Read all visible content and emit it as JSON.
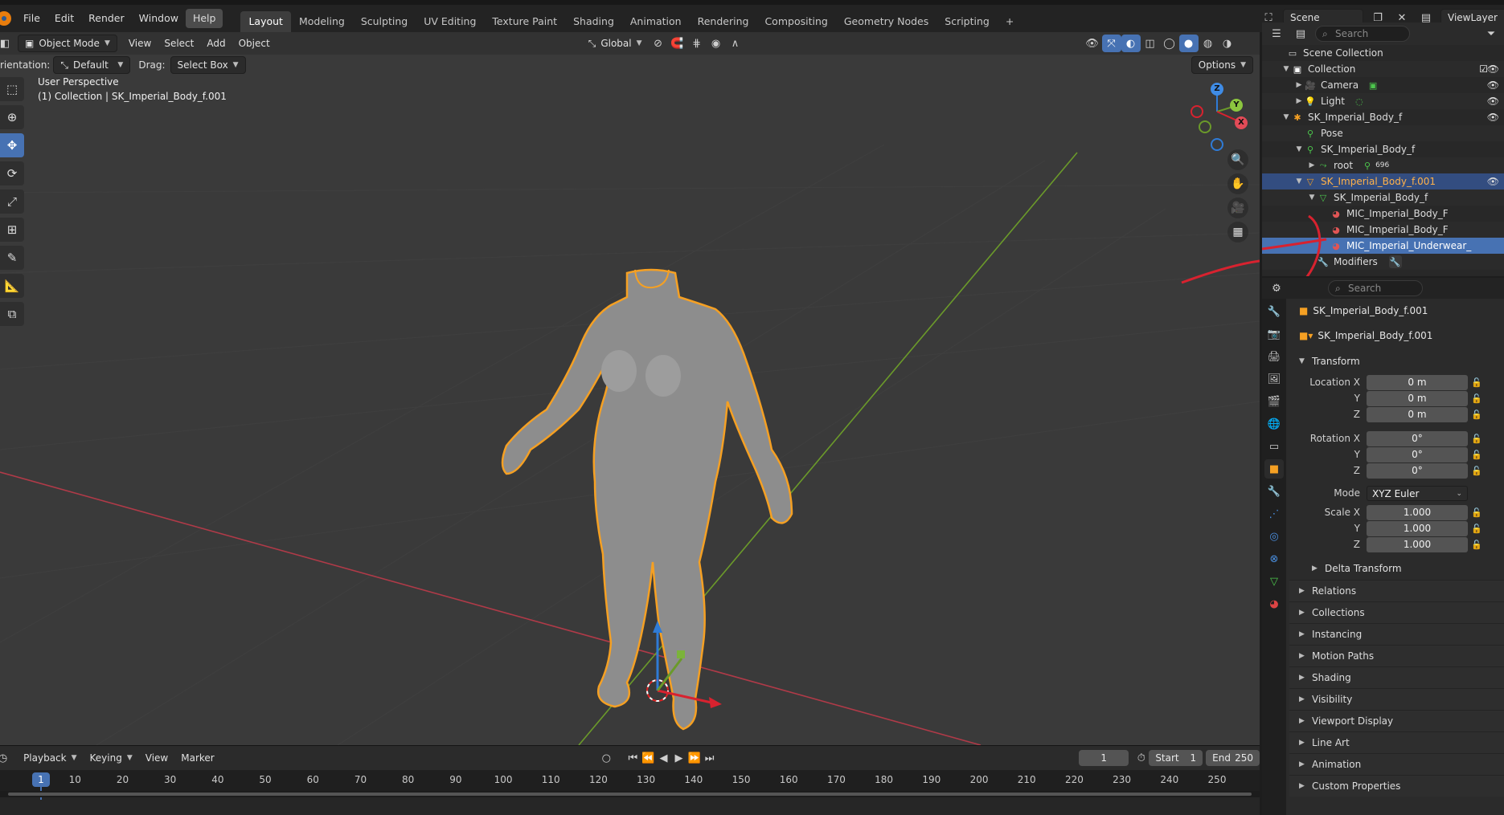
{
  "menu": [
    "File",
    "Edit",
    "Render",
    "Window",
    "Help"
  ],
  "workspaces": [
    "Layout",
    "Modeling",
    "Sculpting",
    "UV Editing",
    "Texture Paint",
    "Shading",
    "Animation",
    "Rendering",
    "Compositing",
    "Geometry Nodes",
    "Scripting",
    "+"
  ],
  "scene": {
    "label": "Scene",
    "view_layer": "ViewLayer"
  },
  "viewport": {
    "mode": "Object Mode",
    "menus": [
      "View",
      "Select",
      "Add",
      "Object"
    ],
    "transform_orientation": "Global",
    "orientation_label": "rientation:",
    "orientation_value": "Default",
    "drag_label": "Drag:",
    "drag_value": "Select Box",
    "options": "Options",
    "perspective": "User Perspective",
    "collection_info": "(1) Collection | SK_Imperial_Body_f.001",
    "gizmo": {
      "x": "X",
      "y": "Y",
      "z": "Z"
    }
  },
  "timeline": {
    "menus": [
      "Playback",
      "Keying",
      "View",
      "Marker"
    ],
    "current_frame": "1",
    "start_label": "Start",
    "start": "1",
    "end_label": "End",
    "end": "250",
    "ticks": [
      "1",
      "10",
      "20",
      "30",
      "40",
      "50",
      "60",
      "70",
      "80",
      "90",
      "100",
      "110",
      "120",
      "130",
      "140",
      "150",
      "160",
      "170",
      "180",
      "190",
      "200",
      "210",
      "220",
      "230",
      "240",
      "250"
    ]
  },
  "outliner": {
    "search_placeholder": "Search",
    "rows": [
      {
        "label": "Scene Collection",
        "indent": 0
      },
      {
        "label": "Collection",
        "indent": 1
      },
      {
        "label": "Camera",
        "indent": 2
      },
      {
        "label": "Light",
        "indent": 2
      },
      {
        "label": "SK_Imperial_Body_f",
        "indent": 1
      },
      {
        "label": "Pose",
        "indent": 2
      },
      {
        "label": "SK_Imperial_Body_f",
        "indent": 2
      },
      {
        "label": "root",
        "indent": 3,
        "badge": "696"
      },
      {
        "label": "SK_Imperial_Body_f.001",
        "indent": 2
      },
      {
        "label": "SK_Imperial_Body_f",
        "indent": 3
      },
      {
        "label": "MIC_Imperial_Body_F",
        "indent": 4
      },
      {
        "label": "MIC_Imperial_Body_F",
        "indent": 4
      },
      {
        "label": "MIC_Imperial_Underwear_",
        "indent": 4
      },
      {
        "label": "Modifiers",
        "indent": 3
      }
    ]
  },
  "properties": {
    "search_placeholder": "Search",
    "object_name": "SK_Imperial_Body_f.001",
    "data_name": "SK_Imperial_Body_f.001",
    "transform_label": "Transform",
    "location": {
      "label": "Location X",
      "x": "0 m",
      "y": "0 m",
      "z": "0 m"
    },
    "rotation": {
      "label": "Rotation X",
      "x": "0°",
      "y": "0°",
      "z": "0°"
    },
    "mode_label": "Mode",
    "mode_value": "XYZ Euler",
    "scale": {
      "label": "Scale X",
      "x": "1.000",
      "y": "1.000",
      "z": "1.000"
    },
    "axis_y": "Y",
    "axis_z": "Z",
    "delta": "Delta Transform",
    "panels": [
      "Relations",
      "Collections",
      "Instancing",
      "Motion Paths",
      "Shading",
      "Visibility",
      "Viewport Display",
      "Line Art",
      "Animation",
      "Custom Properties"
    ]
  },
  "colors": {
    "accent": "#4772b3",
    "selection_outline": "#f5a023",
    "x_axis": "#c7374a",
    "y_axis": "#6b9a2a",
    "annotation": "#d8222f"
  }
}
